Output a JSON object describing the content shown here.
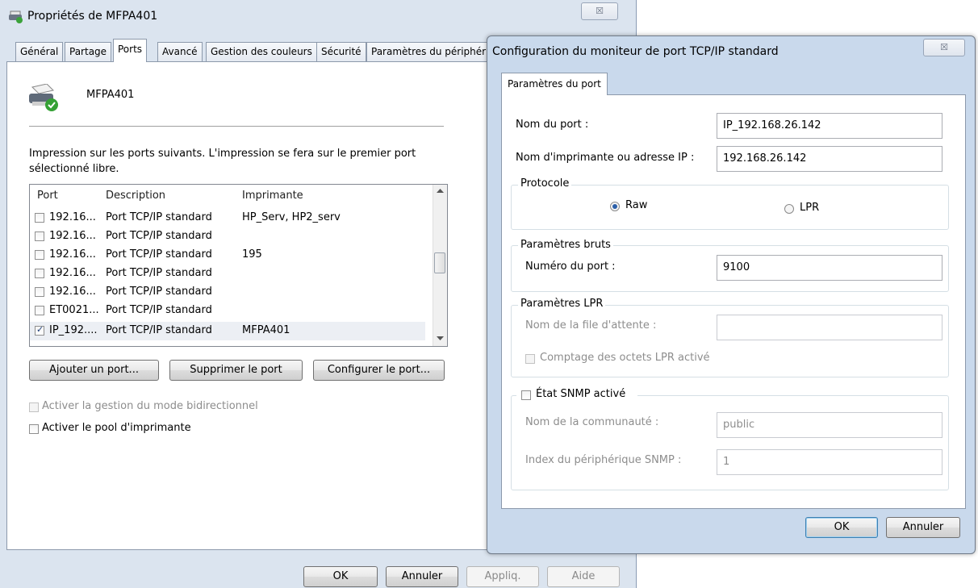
{
  "main_window": {
    "title": "Propriétés de MFPA401",
    "close_glyph": "☒",
    "tabs": [
      "Général",
      "Partage",
      "Ports",
      "Avancé",
      "Gestion des couleurs",
      "Sécurité",
      "Paramètres du périphéri"
    ],
    "active_tab": "Ports",
    "printer_name": "MFPA401",
    "description": "Impression sur les ports suivants. L'impression se fera sur le premier port sélectionné libre.",
    "columns": {
      "port": "Port",
      "description": "Description",
      "printer": "Imprimante"
    },
    "ports": [
      {
        "port": "192.16...",
        "description": "Port TCP/IP standard",
        "printer": "HP_Serv, HP2_serv",
        "checked": false
      },
      {
        "port": "192.16...",
        "description": "Port TCP/IP standard",
        "printer": "",
        "checked": false
      },
      {
        "port": "192.16...",
        "description": "Port TCP/IP standard",
        "printer": "195",
        "checked": false
      },
      {
        "port": "192.16...",
        "description": "Port TCP/IP standard",
        "printer": "",
        "checked": false
      },
      {
        "port": "192.16...",
        "description": "Port TCP/IP standard",
        "printer": "",
        "checked": false
      },
      {
        "port": "ET0021...",
        "description": "Port TCP/IP standard",
        "printer": "",
        "checked": false
      },
      {
        "port": "IP_192....",
        "description": "Port TCP/IP standard",
        "printer": "MFPA401",
        "checked": true
      }
    ],
    "buttons": {
      "add_port": "Ajouter un port...",
      "delete_port": "Supprimer le port",
      "configure_port": "Configurer le port...",
      "ok": "OK",
      "cancel": "Annuler",
      "apply": "Appliq.",
      "help": "Aide"
    },
    "bidirectional_label": "Activer la gestion du mode bidirectionnel",
    "pool_label": "Activer le pool d'imprimante"
  },
  "tcp_dialog": {
    "title": "Configuration du moniteur de port TCP/IP standard",
    "close_glyph": "☒",
    "tab": "Paramètres du port",
    "port_name_label": "Nom du port :",
    "port_name_value": "IP_192.168.26.142",
    "printer_address_label": "Nom d'imprimante ou adresse IP :",
    "printer_address_value": "192.168.26.142",
    "protocol_group": "Protocole",
    "protocol_options": [
      "Raw",
      "LPR"
    ],
    "protocol_selected": "Raw",
    "raw_group": "Paramètres bruts",
    "port_number_label": "Numéro du port :",
    "port_number_value": "9100",
    "lpr_group": "Paramètres LPR",
    "queue_name_label": "Nom de la file d'attente :",
    "queue_name_value": "",
    "lpr_byte_count_label": "Comptage des octets LPR activé",
    "snmp_label": "État SNMP activé",
    "community_label": "Nom de la communauté :",
    "community_value": "public",
    "snmp_index_label": "Index du périphérique SNMP :",
    "snmp_index_value": "1",
    "ok": "OK",
    "cancel": "Annuler"
  }
}
